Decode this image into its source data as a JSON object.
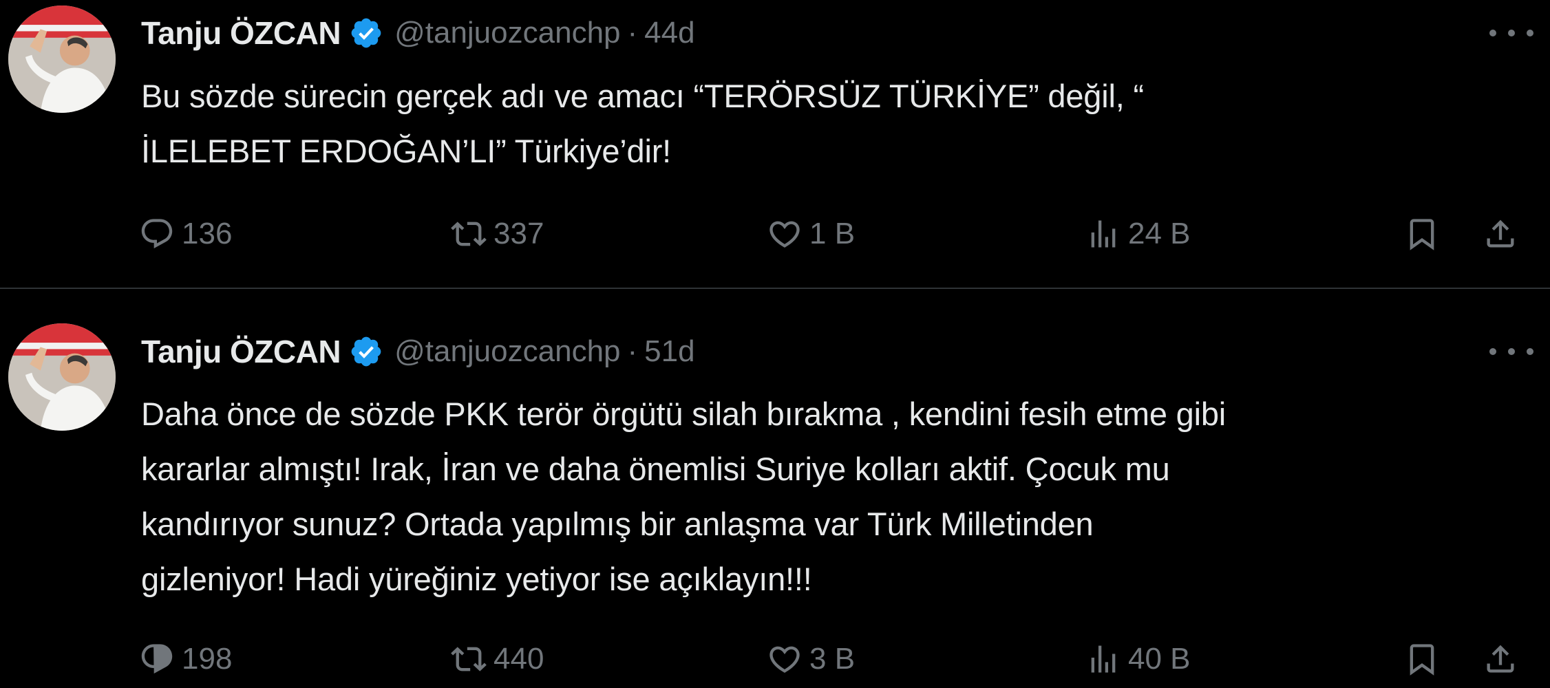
{
  "tweets": [
    {
      "author": {
        "name": "Tanju ÖZCAN",
        "handle": "@tanjuozcanchp",
        "avatar_icon": "avatar-portrait",
        "verified_icon": "verified-badge-icon"
      },
      "separator": "·",
      "time": "44d",
      "text": "Bu sözde sürecin gerçek adı ve amacı “TERÖRSÜZ TÜRKİYE” değil, “\nİLELEBET ERDOĞAN’LI” Türkiye’dir!",
      "stats": {
        "replies": "136",
        "reposts": "337",
        "likes": "1 B",
        "views": "24 B"
      }
    },
    {
      "author": {
        "name": "Tanju ÖZCAN",
        "handle": "@tanjuozcanchp",
        "avatar_icon": "avatar-portrait",
        "verified_icon": "verified-badge-icon"
      },
      "separator": "·",
      "time": "51d",
      "text": "Daha önce de sözde PKK terör örgütü silah bırakma , kendini fesih etme gibi\nkararlar almıştı! Irak, İran ve daha önemlisi Suriye kolları aktif. Çocuk mu\nkandırıyor sunuz? Ortada yapılmış bir anlaşma var Türk Milletinden\ngizleniyor! Hadi yüreğiniz yetiyor ise açıklayın!!!",
      "stats": {
        "replies": "198",
        "reposts": "440",
        "likes": "3 B",
        "views": "40 B"
      }
    }
  ],
  "icons": {
    "more": "more-dots-icon",
    "reply": "reply-icon",
    "repost": "repost-icon",
    "like": "heart-icon",
    "views": "views-chart-icon",
    "bookmark": "bookmark-icon",
    "share": "share-icon"
  },
  "colors": {
    "background": "#000000",
    "text_primary": "#e7e9ea",
    "text_secondary": "#71767b",
    "divider": "#2f3336",
    "verified": "#1d9bf0"
  }
}
